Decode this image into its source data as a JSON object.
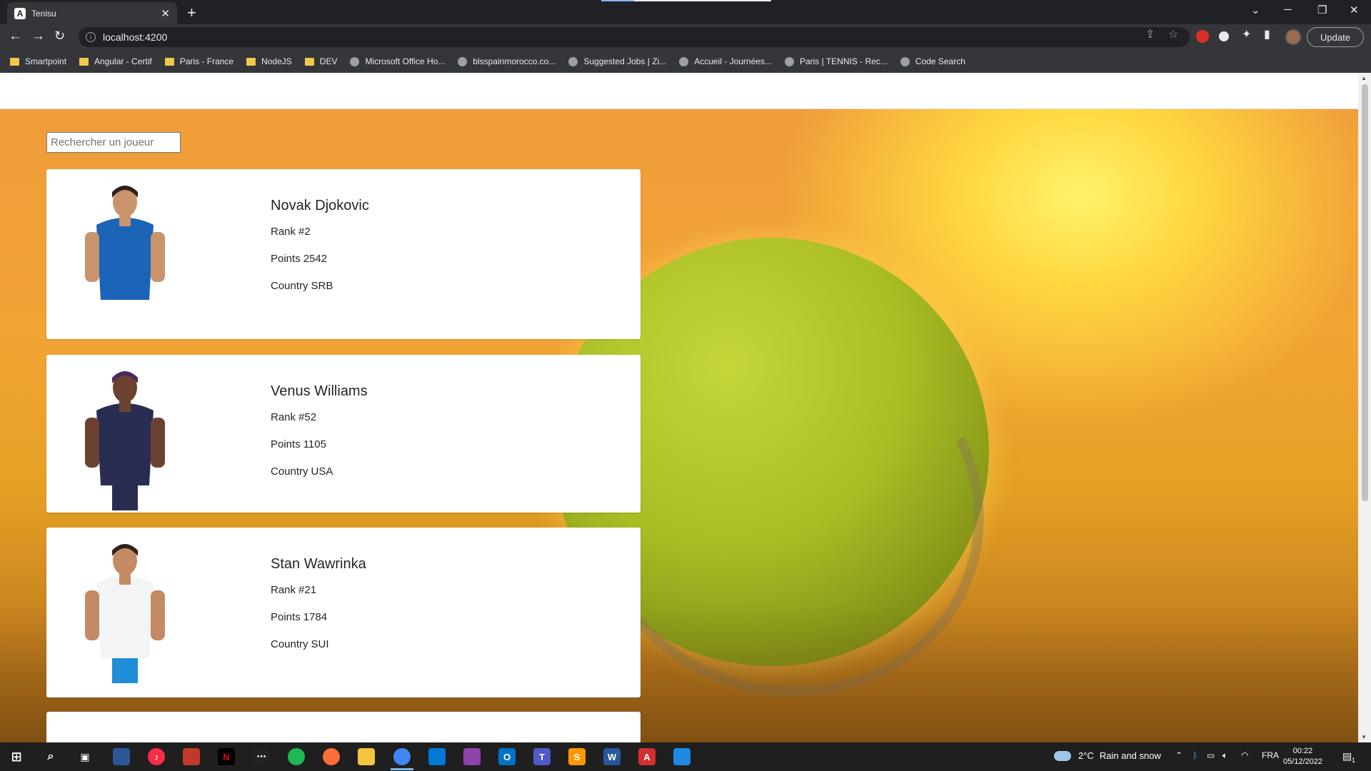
{
  "browser": {
    "tab_title": "Tenisu",
    "tab_favicon": "A",
    "url": "localhost:4200",
    "update_label": "Update",
    "bookmarks": [
      {
        "label": "Smartpoint",
        "icon": "folder-icon"
      },
      {
        "label": "Angular - Certif",
        "icon": "folder-icon"
      },
      {
        "label": "Paris - France",
        "icon": "folder-icon"
      },
      {
        "label": "NodeJS",
        "icon": "folder-icon"
      },
      {
        "label": "DEV",
        "icon": "folder-icon"
      },
      {
        "label": "Microsoft Office Ho...",
        "icon": "microsoft-icon"
      },
      {
        "label": "blsspainmorocco.co...",
        "icon": "globe-icon"
      },
      {
        "label": "Suggested Jobs | Zi...",
        "icon": "ziprecruiter-icon"
      },
      {
        "label": "Accueil - Journées...",
        "icon": "globe-icon"
      },
      {
        "label": "Paris | TENNIS - Rec...",
        "icon": "site-icon"
      },
      {
        "label": "Code Search",
        "icon": "code-search-icon"
      }
    ]
  },
  "page": {
    "search_placeholder": "Rechercher un joueur",
    "field_labels": {
      "rank": "Rank",
      "points": "Points",
      "country": "Country"
    },
    "players": [
      {
        "name": "Novak Djokovic",
        "rank": "#2",
        "points": "2542",
        "country": "SRB",
        "shirt": "#1b64b8",
        "shorts": "#ffffff",
        "skin": "#c9936c",
        "hair": "#2a211a"
      },
      {
        "name": "Venus Williams",
        "rank": "#52",
        "points": "1105",
        "country": "USA",
        "shirt": "#2a2d52",
        "shorts": "#2a2d52",
        "skin": "#6b4230",
        "hair": "#4a2a5e"
      },
      {
        "name": "Stan Wawrinka",
        "rank": "#21",
        "points": "1784",
        "country": "SUI",
        "shirt": "#f2f4f6",
        "shorts": "#1e8fd6",
        "skin": "#c48a64",
        "hair": "#2b231c"
      }
    ]
  },
  "taskbar": {
    "weather_temp": "2°C",
    "weather_text": "Rain and snow",
    "language": "FRA",
    "time": "00:22",
    "date": "05/12/2022",
    "notification_count": "1"
  },
  "colors": {
    "accent": "#8ab4f8",
    "card_bg": "#ffffff",
    "hero_orange": "#f09c3a",
    "ball_green": "#aabd24"
  }
}
